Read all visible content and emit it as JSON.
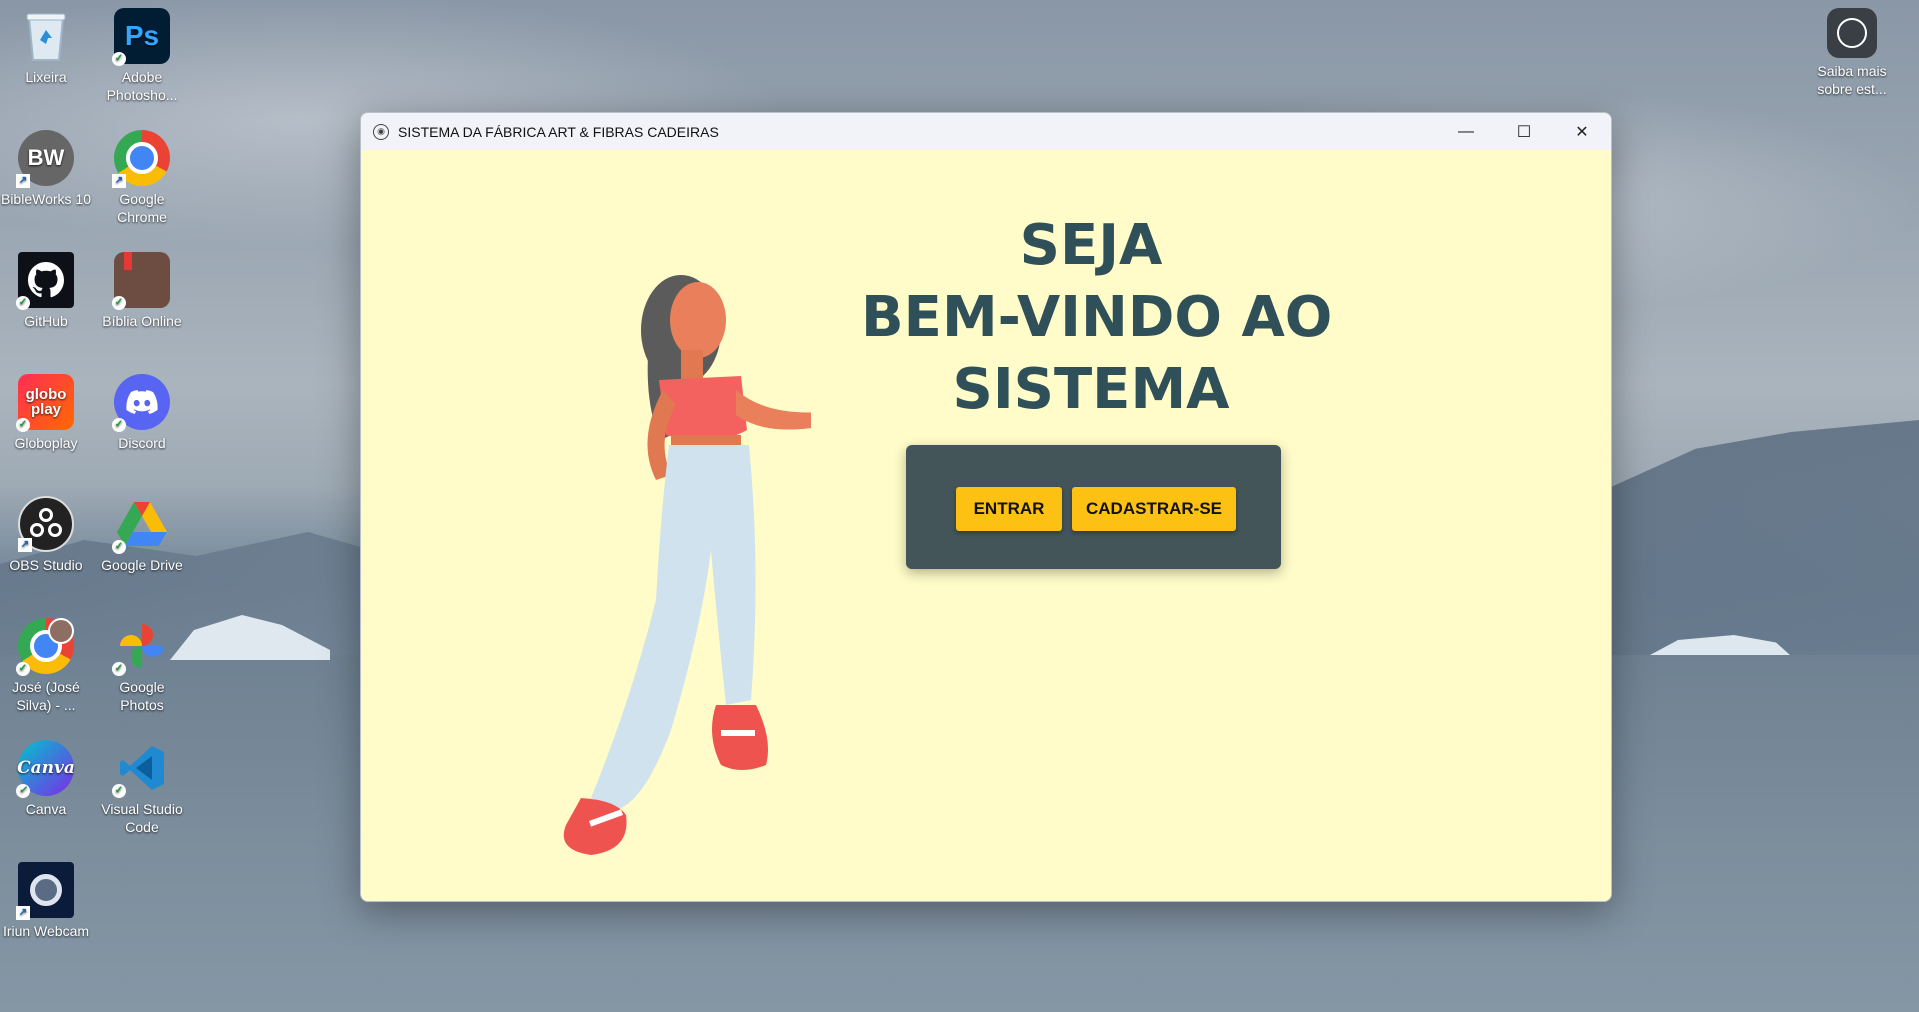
{
  "desktop": {
    "icons": [
      {
        "label": "Lixeira",
        "icon": "recycle-bin-icon"
      },
      {
        "label": "Adobe Photosho...",
        "icon": "photoshop-icon"
      },
      {
        "label": "BibleWorks 10",
        "icon": "bibleworks-icon"
      },
      {
        "label": "Google Chrome",
        "icon": "chrome-icon"
      },
      {
        "label": "GitHub",
        "icon": "github-icon"
      },
      {
        "label": "Bíblia Online",
        "icon": "bible-online-icon"
      },
      {
        "label": "Globoplay",
        "icon": "globoplay-icon"
      },
      {
        "label": "Discord",
        "icon": "discord-icon"
      },
      {
        "label": "OBS Studio",
        "icon": "obs-icon"
      },
      {
        "label": "Google Drive",
        "icon": "google-drive-icon"
      },
      {
        "label": "José (José Silva) - ...",
        "icon": "chrome-profile-icon"
      },
      {
        "label": "Google Photos",
        "icon": "google-photos-icon"
      },
      {
        "label": "Canva",
        "icon": "canva-icon"
      },
      {
        "label": "Visual Studio Code",
        "icon": "vscode-icon"
      },
      {
        "label": "Iriun Webcam",
        "icon": "iriun-icon"
      },
      {
        "label": "Saiba mais sobre est...",
        "icon": "learn-more-icon"
      }
    ],
    "tile_texts": {
      "ps": "Ps",
      "bw": "BW",
      "globo": "globo play",
      "canva": "Canva"
    }
  },
  "window": {
    "title": "SISTEMA DA FÁBRICA ART & FIBRAS CADEIRAS",
    "controls": {
      "minimize": "—",
      "maximize": "☐",
      "close": "✕"
    }
  },
  "welcome": {
    "line1": "SEJA",
    "line2": "BEM-VINDO AO",
    "line3": "SISTEMA"
  },
  "buttons": {
    "login": "ENTRAR",
    "register": "CADASTRAR-SE"
  },
  "colors": {
    "window_bg": "#fffcc9",
    "heading": "#2f5058",
    "panel": "#435559",
    "button": "#fdc113"
  }
}
